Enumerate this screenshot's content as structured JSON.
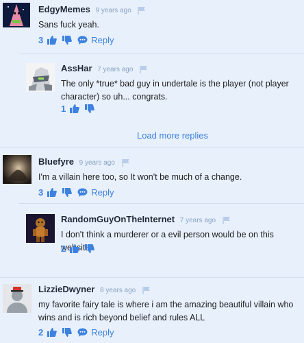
{
  "comments": [
    {
      "author": "EdgyMemes",
      "time": "9 years ago",
      "text": "Sans fuck yeah.",
      "likes": "3",
      "reply_label": "Reply"
    },
    {
      "author": "AssHar",
      "time": "7 years ago",
      "text": "The only *true* bad guy in undertale is the player (not player character) so uh... congrats.",
      "likes": "1",
      "reply_label": ""
    },
    {
      "author": "Bluefyre",
      "time": "9 years ago",
      "text": "I'm a villain here too, so It won't be much of a change.",
      "likes": "3",
      "reply_label": "Reply"
    },
    {
      "author": "RandomGuyOnTheInternet",
      "time": "7 years ago",
      "text": "I don't think a murderer or a evil person would be on this website",
      "likes": "2",
      "reply_label": ""
    },
    {
      "author": "LizzieDwyner",
      "time": "8 years ago",
      "text": "my favorite fairy tale is where i am the amazing beautiful villain who wins and is rich beyond belief and rules ALL",
      "likes": "2",
      "reply_label": "Reply"
    }
  ],
  "load_more_label": "Load more replies",
  "colors": {
    "accent": "#3d82e0",
    "background": "#e8f0fb",
    "timestamp": "#8aa3c2"
  }
}
